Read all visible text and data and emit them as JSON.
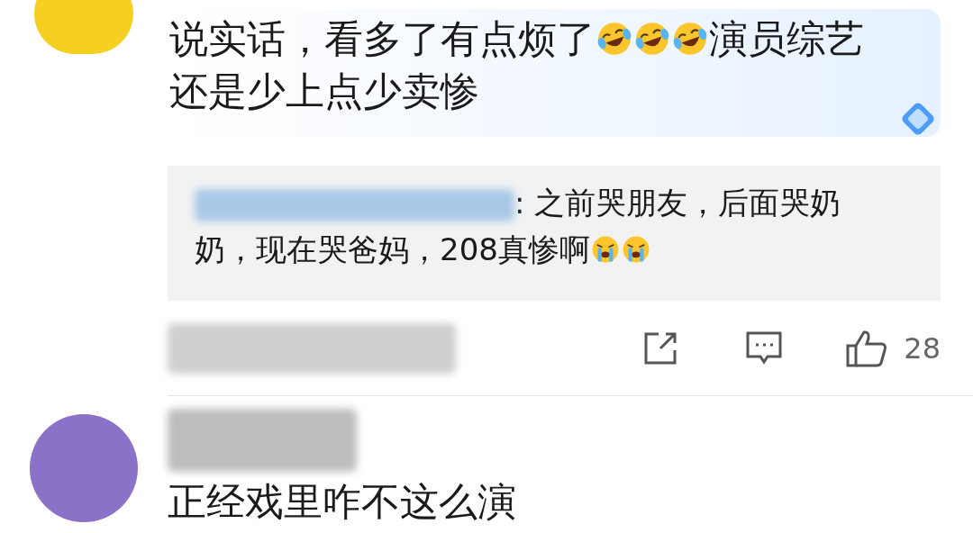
{
  "comments": [
    {
      "color": "#f5d020",
      "text": [
        {
          "kind": "text",
          "text": "说实话，看多了有点烦了"
        },
        {
          "kind": "emoji"
        },
        {
          "kind": "emoji"
        },
        {
          "kind": "emoji"
        },
        {
          "kind": "text",
          "text": "演员综艺还是少上点少卖惨"
        }
      ],
      "highlighted": true,
      "reply": {
        "text": [
          {
            "kind": "text",
            "text": ": 之前哭朋友，后面哭奶奶，现在哭爸妈，208真惨啊"
          },
          {
            "kind": "cry"
          },
          {
            "kind": "cry"
          }
        ]
      },
      "likes": "28"
    },
    {
      "color": "#8a72c8",
      "text": [
        {
          "kind": "text",
          "text": "正经戏里咋不这么演"
        }
      ],
      "highlighted": false
    }
  ]
}
